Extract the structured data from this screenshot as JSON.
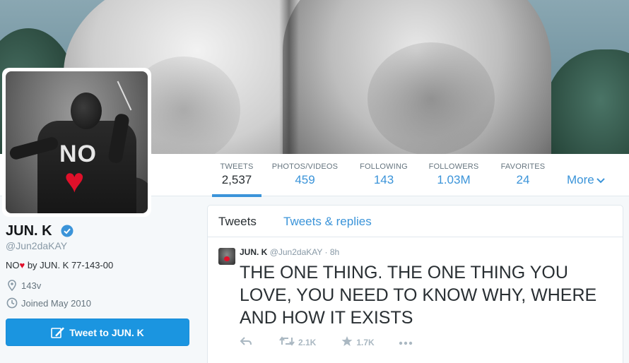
{
  "profile": {
    "name": "JUN. K",
    "handle": "@Jun2daKAY",
    "bio_prefix": "NO",
    "bio_suffix": " by JUN. K 77-143-00",
    "location": "143v",
    "joined": "Joined May 2010",
    "tweet_to_label": "Tweet to JUN. K"
  },
  "avatar": {
    "sweater_text": "NO"
  },
  "nav": {
    "stats": [
      {
        "label": "TWEETS",
        "value": "2,537"
      },
      {
        "label": "PHOTOS/VIDEOS",
        "value": "459"
      },
      {
        "label": "FOLLOWING",
        "value": "143"
      },
      {
        "label": "FOLLOWERS",
        "value": "1.03M"
      },
      {
        "label": "FAVORITES",
        "value": "24"
      }
    ],
    "more_label": "More"
  },
  "timeline": {
    "tabs": [
      {
        "label": "Tweets"
      },
      {
        "label": "Tweets & replies"
      }
    ],
    "tweet": {
      "name": "JUN. K",
      "handle": "@Jun2daKAY",
      "dot": "·",
      "time": "8h",
      "text": "THE ONE THING. THE ONE THING YOU LOVE, YOU NEED TO KNOW WHY, WHERE AND HOW IT EXISTS",
      "retweets": "2.1K",
      "favorites": "1.7K"
    }
  },
  "colors": {
    "link_blue": "#3b94d9",
    "button_blue": "#1b95e0",
    "heart_red": "#e0102a"
  },
  "icons": [
    "verified-badge-icon",
    "location-pin-icon",
    "clock-icon",
    "quill-icon",
    "chevron-down-icon",
    "reply-icon",
    "retweet-icon",
    "star-icon",
    "more-dots-icon"
  ]
}
